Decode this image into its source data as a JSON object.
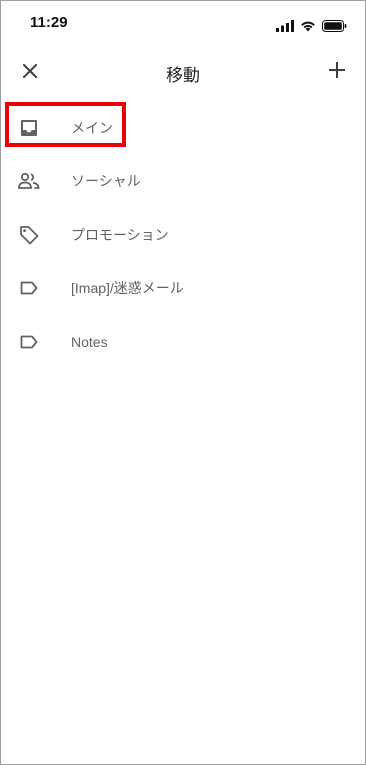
{
  "status_bar": {
    "time": "11:29",
    "icons": [
      "signal-icon",
      "wifi-icon",
      "battery-icon"
    ]
  },
  "app_bar": {
    "title": "移動",
    "close_icon": "close-icon",
    "add_icon": "plus-icon"
  },
  "folders": [
    {
      "label": "メイン",
      "icon": "inbox-icon"
    },
    {
      "label": "ソーシャル",
      "icon": "people-icon"
    },
    {
      "label": "プロモーション",
      "icon": "tag-icon"
    },
    {
      "label": "[Imap]/迷惑メール",
      "icon": "label-icon"
    },
    {
      "label": "Notes",
      "icon": "label-icon"
    }
  ],
  "colors": {
    "highlight": "#e8000b",
    "icon": "#5f6368",
    "text": "#5f6368"
  }
}
